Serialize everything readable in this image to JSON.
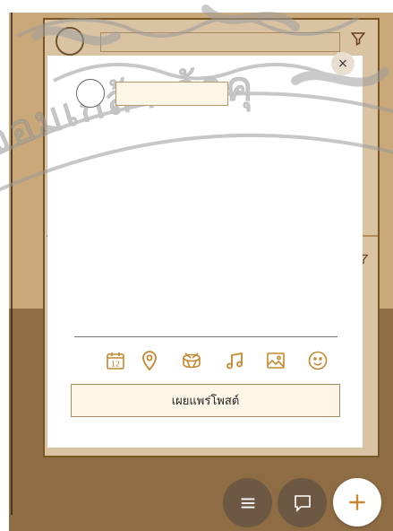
{
  "colors": {
    "accent": "#c6872f",
    "backdrop": "#c9a87a",
    "overlay_dark": "#8e6c44",
    "field_fill": "#fdf6e6",
    "fab_dark": "#6d5843"
  },
  "watermark": {
    "text": "จอมเกล้าเจ้าคุ"
  },
  "modal": {
    "close_label": "×",
    "name_value": "",
    "toolbar": [
      {
        "icon": "calendar-icon",
        "day": "12"
      },
      {
        "icon": "location-pin-icon"
      },
      {
        "icon": "drum-icon"
      },
      {
        "icon": "music-note-icon"
      },
      {
        "icon": "image-icon"
      },
      {
        "icon": "smiley-icon"
      }
    ],
    "publish_label": "เผยแพร่โพสต์"
  },
  "fabs": {
    "menu_icon": "menu-icon",
    "chat_icon": "chat-icon",
    "add_icon": "plus-icon"
  }
}
